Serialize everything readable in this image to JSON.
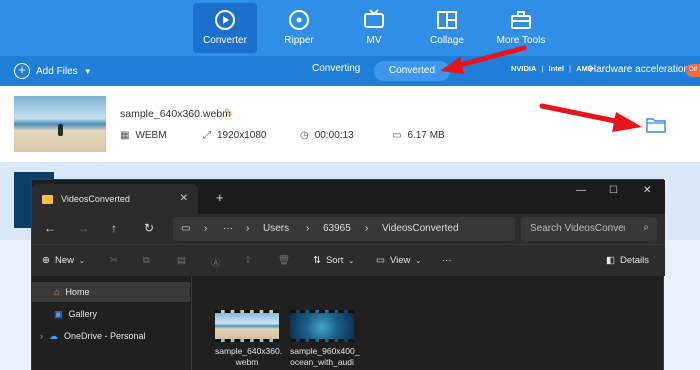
{
  "app": {
    "tabs": [
      {
        "label": "Converter",
        "icon": "converter-icon"
      },
      {
        "label": "Ripper",
        "icon": "dvd-icon"
      },
      {
        "label": "MV",
        "icon": "tv-icon"
      },
      {
        "label": "Collage",
        "icon": "collage-icon"
      },
      {
        "label": "More Tools",
        "icon": "toolbox-icon"
      }
    ],
    "add_files_label": "Add Files",
    "subtabs": [
      "Converting",
      "Converted"
    ],
    "hw_brands": [
      "NVIDIA",
      "Intel",
      "AMD"
    ],
    "hw_label": "Hardware acceleration",
    "hw_toggle": "Off",
    "file": {
      "name": "sample_640x360.webm",
      "format": "WEBM",
      "resolution": "1920x1080",
      "duration": "00:00:13",
      "size": "6.17 MB"
    },
    "colors": {
      "brand": "#2f8fe6",
      "arrow": "#e8141c"
    }
  },
  "explorer": {
    "tab_title": "VideosConverted",
    "path": [
      "Users",
      "63965",
      "VideosConverted"
    ],
    "search_placeholder": "Search VideosConverted",
    "commands": {
      "new": "New",
      "sort": "Sort",
      "view": "View",
      "details": "Details"
    },
    "nav": [
      {
        "label": "Home",
        "icon": "home-icon"
      },
      {
        "label": "Gallery",
        "icon": "gallery-icon"
      },
      {
        "label": "OneDrive - Personal",
        "icon": "onedrive-icon"
      }
    ],
    "files": [
      {
        "line1": "sample_640x360.",
        "line2": "webm"
      },
      {
        "line1": "sample_960x400_",
        "line2": "ocean_with_audi"
      }
    ]
  }
}
